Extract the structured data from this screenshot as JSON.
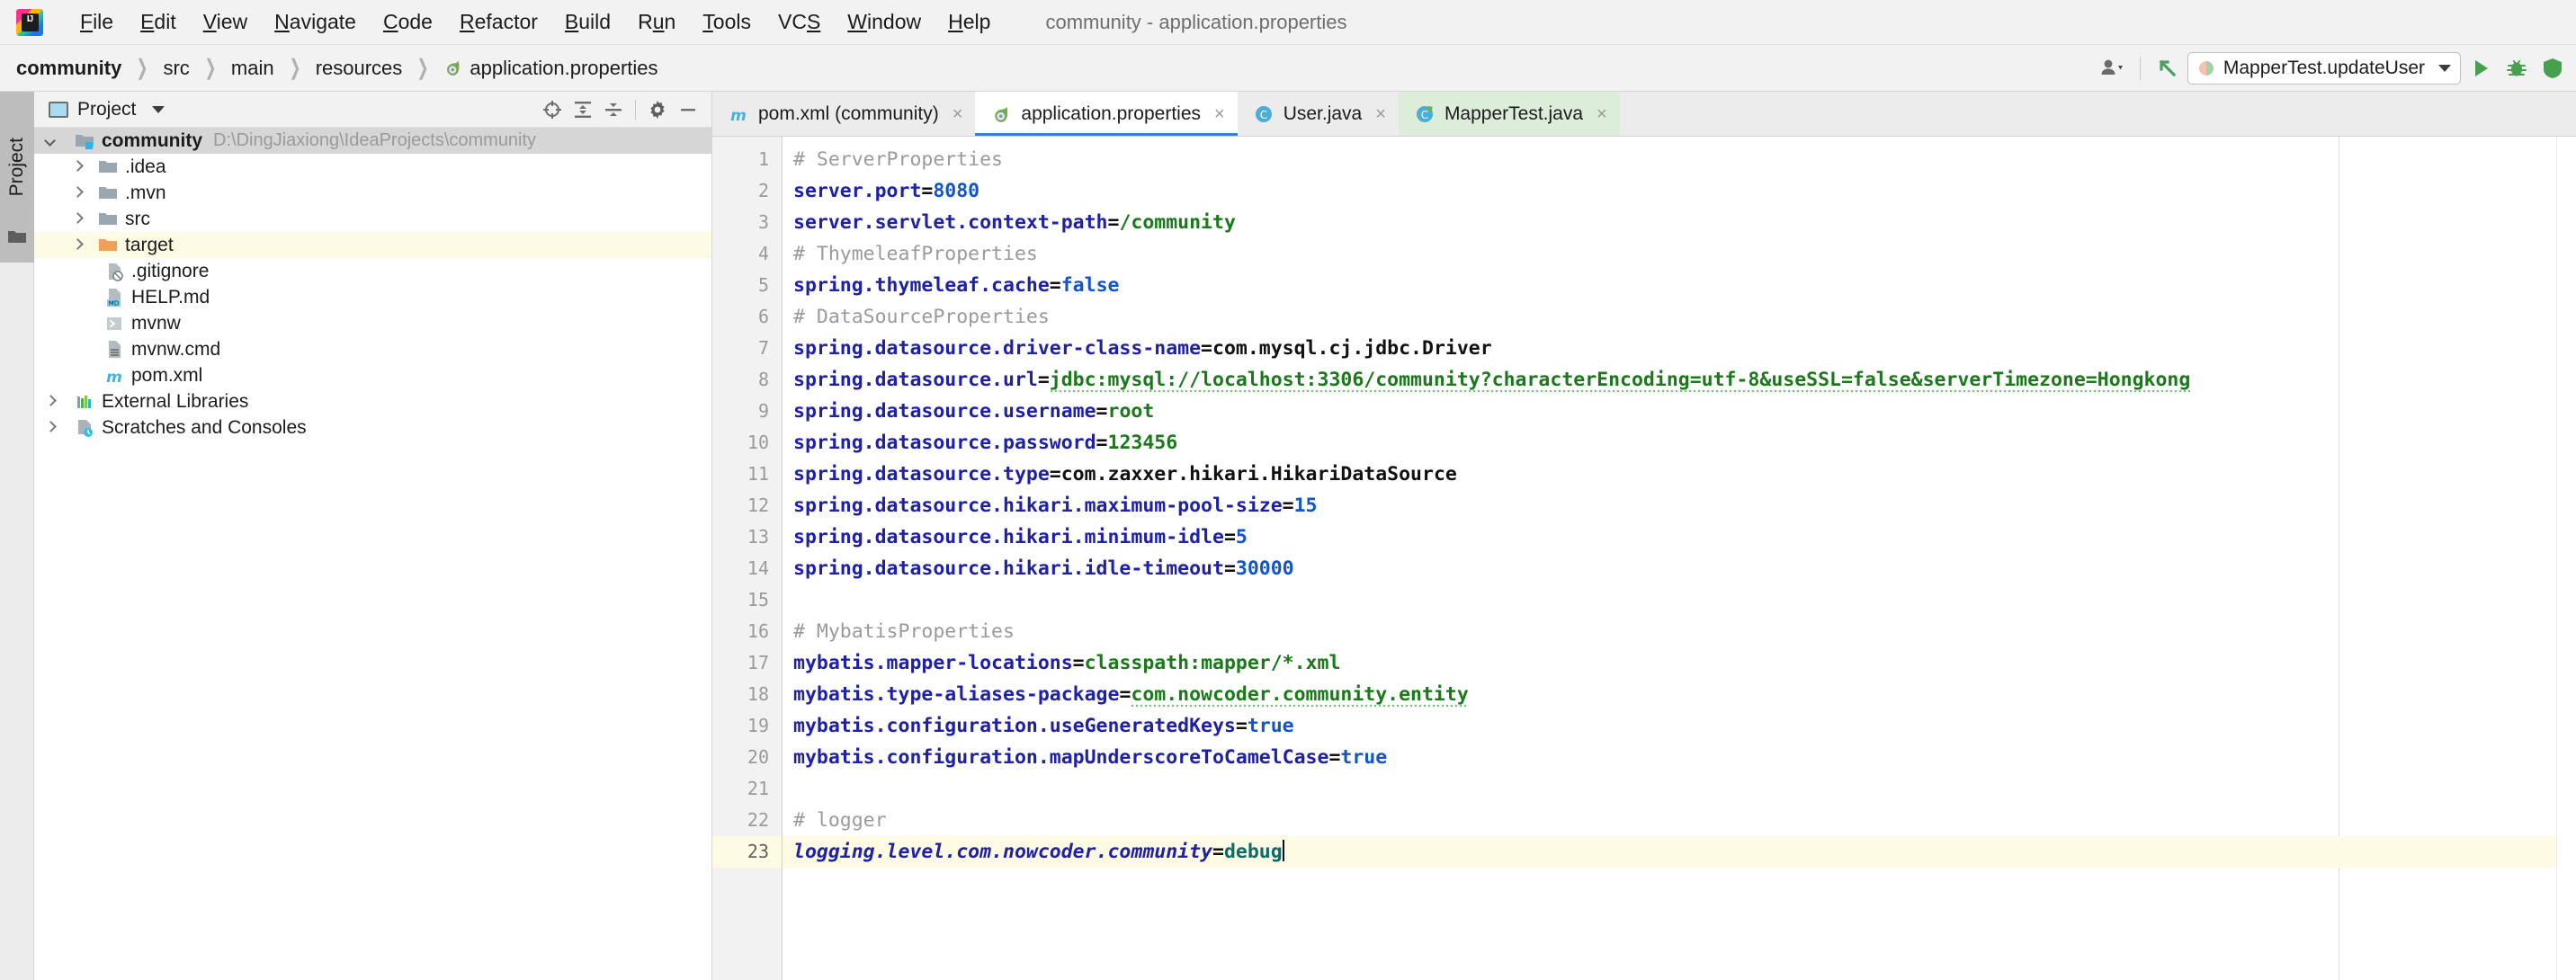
{
  "window": {
    "title": "community - application.properties",
    "app_icon": "intellij-idea-logo"
  },
  "menubar": {
    "items": [
      {
        "label": "File",
        "mnemonic_index": 0
      },
      {
        "label": "Edit",
        "mnemonic_index": 0
      },
      {
        "label": "View",
        "mnemonic_index": 0
      },
      {
        "label": "Navigate",
        "mnemonic_index": 0
      },
      {
        "label": "Code",
        "mnemonic_index": 0
      },
      {
        "label": "Refactor",
        "mnemonic_index": 0
      },
      {
        "label": "Build",
        "mnemonic_index": 0
      },
      {
        "label": "Run",
        "mnemonic_index": 1
      },
      {
        "label": "Tools",
        "mnemonic_index": 0
      },
      {
        "label": "VCS",
        "mnemonic_index": 2
      },
      {
        "label": "Window",
        "mnemonic_index": 0
      },
      {
        "label": "Help",
        "mnemonic_index": 0
      }
    ]
  },
  "breadcrumb": {
    "separator": "›",
    "items": [
      {
        "label": "community",
        "bold": true,
        "icon": null
      },
      {
        "label": "src",
        "bold": false,
        "icon": null
      },
      {
        "label": "main",
        "bold": false,
        "icon": null
      },
      {
        "label": "resources",
        "bold": false,
        "icon": null
      },
      {
        "label": "application.properties",
        "bold": false,
        "icon": "spring-leaf-icon"
      }
    ]
  },
  "navbar_right": {
    "user_icon": "user-avatar-dropdown-icon",
    "update_icon": "update-project-arrow-icon",
    "run_config": {
      "label": "MapperTest.updateUser",
      "icon": "junit-run-config-icon",
      "dropdown": "chevron-down-icon"
    },
    "run_button": "run-play-icon",
    "debug_button": "debug-bug-icon",
    "coverage_button": "run-with-coverage-icon"
  },
  "tool_strip": {
    "tabs": [
      {
        "label": "Project",
        "icon": "project-folder-icon",
        "active": true
      }
    ]
  },
  "project_panel": {
    "header": {
      "title": "Project",
      "window_icon": "tool-window-icon",
      "dropdown": "chevron-down-icon",
      "actions": [
        {
          "name": "locate-in-tree-icon"
        },
        {
          "name": "expand-all-icon"
        },
        {
          "name": "collapse-all-icon"
        },
        {
          "name": "settings-gear-icon"
        },
        {
          "name": "hide-panel-icon"
        }
      ]
    },
    "tree": [
      {
        "label": "community",
        "path": "D:\\DingJiaxiong\\IdeaProjects\\community",
        "icon": "module-folder-icon",
        "arrow": "down",
        "indent": 0,
        "bold": true,
        "state": "selected"
      },
      {
        "label": ".idea",
        "icon": "folder-icon",
        "arrow": "right",
        "indent": 1,
        "state": "normal"
      },
      {
        "label": ".mvn",
        "icon": "folder-icon",
        "arrow": "right",
        "indent": 1,
        "state": "normal"
      },
      {
        "label": "src",
        "icon": "folder-icon",
        "arrow": "right",
        "indent": 1,
        "state": "normal"
      },
      {
        "label": "target",
        "icon": "folder-orange-icon",
        "arrow": "right",
        "indent": 1,
        "state": "highlighted"
      },
      {
        "label": ".gitignore",
        "icon": "gitignore-file-icon",
        "arrow": "none",
        "indent": 2,
        "state": "normal"
      },
      {
        "label": "HELP.md",
        "icon": "markdown-file-icon",
        "arrow": "none",
        "indent": 2,
        "state": "normal"
      },
      {
        "label": "mvnw",
        "icon": "shell-script-icon",
        "arrow": "none",
        "indent": 2,
        "state": "normal"
      },
      {
        "label": "mvnw.cmd",
        "icon": "cmd-file-icon",
        "arrow": "none",
        "indent": 2,
        "state": "normal"
      },
      {
        "label": "pom.xml",
        "icon": "maven-file-icon",
        "arrow": "none",
        "indent": 2,
        "state": "normal"
      },
      {
        "label": "External Libraries",
        "icon": "libraries-icon",
        "arrow": "right",
        "indent": 0,
        "state": "normal"
      },
      {
        "label": "Scratches and Consoles",
        "icon": "scratches-icon",
        "arrow": "right",
        "indent": 0,
        "state": "normal"
      }
    ]
  },
  "editor": {
    "tabs": [
      {
        "label": "pom.xml (community)",
        "icon": "maven-file-icon",
        "state": "inactive",
        "close": "×"
      },
      {
        "label": "application.properties",
        "icon": "spring-leaf-icon",
        "state": "active",
        "close": "×"
      },
      {
        "label": "User.java",
        "icon": "java-class-icon",
        "state": "inactive",
        "close": "×"
      },
      {
        "label": "MapperTest.java",
        "icon": "java-test-class-icon",
        "state": "test-green",
        "close": "×"
      }
    ],
    "current_line": 23,
    "caret_after": "debug",
    "lines": [
      {
        "n": 1,
        "type": "comment",
        "text": "# ServerProperties"
      },
      {
        "n": 2,
        "type": "prop",
        "key": "server.port",
        "value": "8080",
        "value_kind": "number"
      },
      {
        "n": 3,
        "type": "prop",
        "key": "server.servlet.context-path",
        "value": "/community",
        "value_kind": "string"
      },
      {
        "n": 4,
        "type": "comment",
        "text": "# ThymeleafProperties"
      },
      {
        "n": 5,
        "type": "prop",
        "key": "spring.thymeleaf.cache",
        "value": "false",
        "value_kind": "number"
      },
      {
        "n": 6,
        "type": "comment",
        "text": "# DataSourceProperties"
      },
      {
        "n": 7,
        "type": "prop",
        "key": "spring.datasource.driver-class-name",
        "value": "com.mysql.cj.jdbc.Driver",
        "value_kind": "plain"
      },
      {
        "n": 8,
        "type": "prop",
        "key": "spring.datasource.url",
        "value": "jdbc:mysql://localhost:3306/community?characterEncoding=utf-8&useSSL=false&serverTimezone=Hongkong",
        "value_kind": "string",
        "squiggle_tail": "Hongkong"
      },
      {
        "n": 9,
        "type": "prop",
        "key": "spring.datasource.username",
        "value": "root",
        "value_kind": "string"
      },
      {
        "n": 10,
        "type": "prop",
        "key": "spring.datasource.password",
        "value": "123456",
        "value_kind": "string"
      },
      {
        "n": 11,
        "type": "prop",
        "key": "spring.datasource.type",
        "value": "com.zaxxer.hikari.HikariDataSource",
        "value_kind": "plain"
      },
      {
        "n": 12,
        "type": "prop",
        "key": "spring.datasource.hikari.maximum-pool-size",
        "value": "15",
        "value_kind": "number"
      },
      {
        "n": 13,
        "type": "prop",
        "key": "spring.datasource.hikari.minimum-idle",
        "value": "5",
        "value_kind": "number"
      },
      {
        "n": 14,
        "type": "prop",
        "key": "spring.datasource.hikari.idle-timeout",
        "value": "30000",
        "value_kind": "number"
      },
      {
        "n": 15,
        "type": "blank",
        "text": ""
      },
      {
        "n": 16,
        "type": "comment",
        "text": "# MybatisProperties"
      },
      {
        "n": 17,
        "type": "prop",
        "key": "mybatis.mapper-locations",
        "value": "classpath:mapper/*.xml",
        "value_kind": "string"
      },
      {
        "n": 18,
        "type": "prop",
        "key": "mybatis.type-aliases-package",
        "value": "com.nowcoder.community.entity",
        "value_kind": "string",
        "squiggle_part": "nowcoder"
      },
      {
        "n": 19,
        "type": "prop",
        "key": "mybatis.configuration.useGeneratedKeys",
        "value": "true",
        "value_kind": "number"
      },
      {
        "n": 20,
        "type": "prop",
        "key": "mybatis.configuration.mapUnderscoreToCamelCase",
        "value": "true",
        "value_kind": "number"
      },
      {
        "n": 21,
        "type": "blank",
        "text": ""
      },
      {
        "n": 22,
        "type": "comment",
        "text": "# logger"
      },
      {
        "n": 23,
        "type": "prop",
        "key": "logging.level.com.nowcoder.community",
        "value": "debug",
        "value_kind": "teal",
        "current": true
      }
    ]
  },
  "colors": {
    "key": "#1e21a8",
    "value_string": "#1a7a1a",
    "value_number": "#1155cc",
    "comment": "#9a9a9a",
    "current_line_bg": "#fdfbe3",
    "active_tab_underline": "#3b7ddd",
    "selection_bg": "#d6d6d6",
    "test_tab_bg": "#dcedd9"
  }
}
